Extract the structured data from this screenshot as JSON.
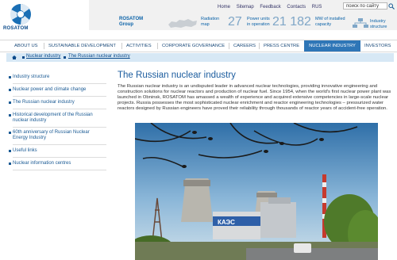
{
  "header": {
    "logo_text": "ROSATOM",
    "top_links": [
      "Home",
      "Sitemap",
      "Feedback",
      "Contacts",
      "RUS"
    ],
    "search_value": "поиск по сайту",
    "rosatom_group": [
      "ROSATOM",
      "Group"
    ],
    "radiation_map": [
      "Radiation",
      "map"
    ],
    "power_units_number": "27",
    "power_units_label": [
      "Power units",
      "in operation"
    ],
    "capacity_number": "21 182",
    "capacity_label": [
      "MW of installed",
      "capacity"
    ],
    "industry_structure": [
      "Industry",
      "structure"
    ]
  },
  "nav": {
    "items": [
      "ABOUT US",
      "SUSTAINABLE DEVELOPMENT",
      "ACTIVITIES",
      "CORPORATE GOVERNANCE",
      "CAREERS",
      "PRESS CENTRE",
      "NUCLEAR INDUSTRY",
      "INVESTORS"
    ],
    "active": "NUCLEAR INDUSTRY"
  },
  "breadcrumb": [
    "Nuclear industry",
    "The Russian nuclear industry"
  ],
  "sidebar": {
    "items": [
      "Industry structure",
      "Nuclear power and climate change",
      "The Russian nuclear industry",
      "Historical development of the Russian nuclear industry",
      "60th anniversary of Russian Nuclear Energy Industry",
      "Useful links",
      "Nuclear information centres"
    ]
  },
  "main": {
    "title": "The Russian nuclear industry",
    "paragraph": "The Russian nuclear industry is an undisputed leader in advanced nuclear technologies, providing innovative engineering and construction solutions for nuclear reactors and production of nuclear fuel. Since 1954, when the world's first nuclear power plant was launched in Obninsk, ROSATOM has amassed a wealth of experience and acquired extensive competencies in large-scale nuclear projects. Russia possesses the most sophisticated nuclear enrichment and reactor engineering technologies – pressurized water reactors designed by Russian engineers have proved their reliability through thousands of reactor years of accident-free operation.",
    "photo_sign": "КАЭС"
  },
  "colors": {
    "accent": "#2f76b7",
    "link": "#1a5a94",
    "breadcrumb_bg": "#d7e8f5"
  }
}
